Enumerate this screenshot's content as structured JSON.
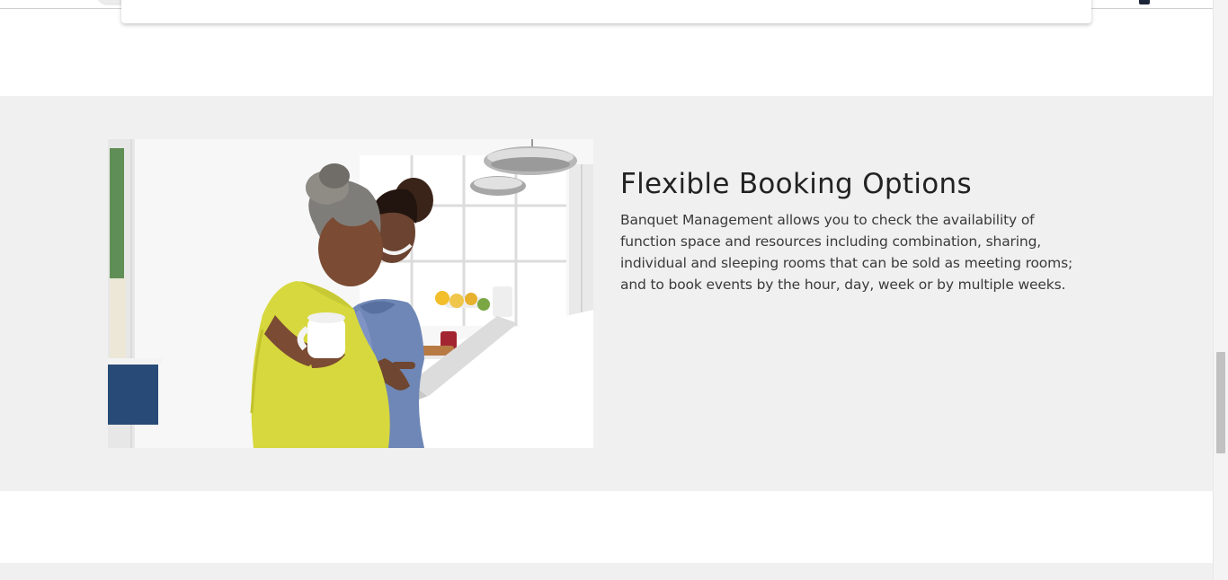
{
  "feature": {
    "title": "Flexible Booking Options",
    "description_lines": [
      "Banquet Management allows you to check the availability of",
      "function space and resources including combination, sharing,",
      "individual and sleeping rooms that can be sold as meeting rooms;",
      "and to book events by the hour, day, week or by multiple weeks."
    ]
  },
  "colors": {
    "section_background": "#f0f0f0",
    "page_background": "#ffffff",
    "title_text": "#222222",
    "body_text": "#3a3a3a"
  },
  "scroll": {
    "position_fraction": 0.61
  }
}
